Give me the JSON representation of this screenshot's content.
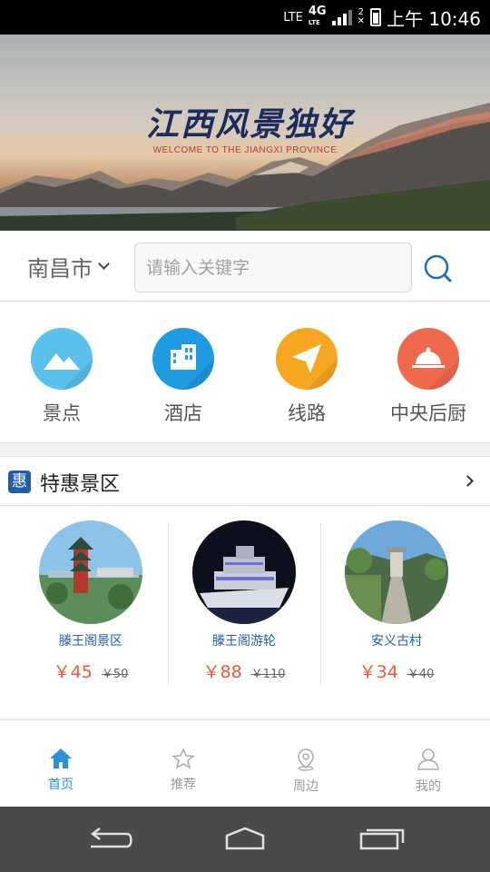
{
  "status_bar": {
    "network": "4G",
    "network_sub": "LTE",
    "carrier_left": "LTE",
    "sim": "2",
    "time": "上午 10:46"
  },
  "banner": {
    "title": "江西风景独好",
    "subtitle": "WELCOME TO THE JIANGXI PROVINCE"
  },
  "search": {
    "city": "南昌市",
    "placeholder": "请输入关键字"
  },
  "categories": [
    {
      "label": "景点",
      "icon": "mountain-icon",
      "color": "#5bc0ec"
    },
    {
      "label": "酒店",
      "icon": "building-icon",
      "color": "#1f9be0"
    },
    {
      "label": "线路",
      "icon": "paper-plane-icon",
      "color": "#f6a623"
    },
    {
      "label": "中央后厨",
      "icon": "food-cloche-icon",
      "color": "#ef6a4c"
    }
  ],
  "special": {
    "badge": "惠",
    "title": "特惠景区",
    "items": [
      {
        "name": "滕王阁景区",
        "price": "￥45",
        "original": "￥50"
      },
      {
        "name": "滕王阁游轮",
        "price": "￥88",
        "original": "￥110"
      },
      {
        "name": "安义古村",
        "price": "￥34",
        "original": "￥40"
      }
    ]
  },
  "tabs": [
    {
      "label": "首页",
      "icon": "home-icon",
      "active": true
    },
    {
      "label": "推荐",
      "icon": "star-icon",
      "active": false
    },
    {
      "label": "周边",
      "icon": "location-pin-icon",
      "active": false
    },
    {
      "label": "我的",
      "icon": "user-icon",
      "active": false
    }
  ],
  "colors": {
    "accent": "#2c8fd8",
    "price": "#e85a3d",
    "link": "#1f5fa8"
  }
}
